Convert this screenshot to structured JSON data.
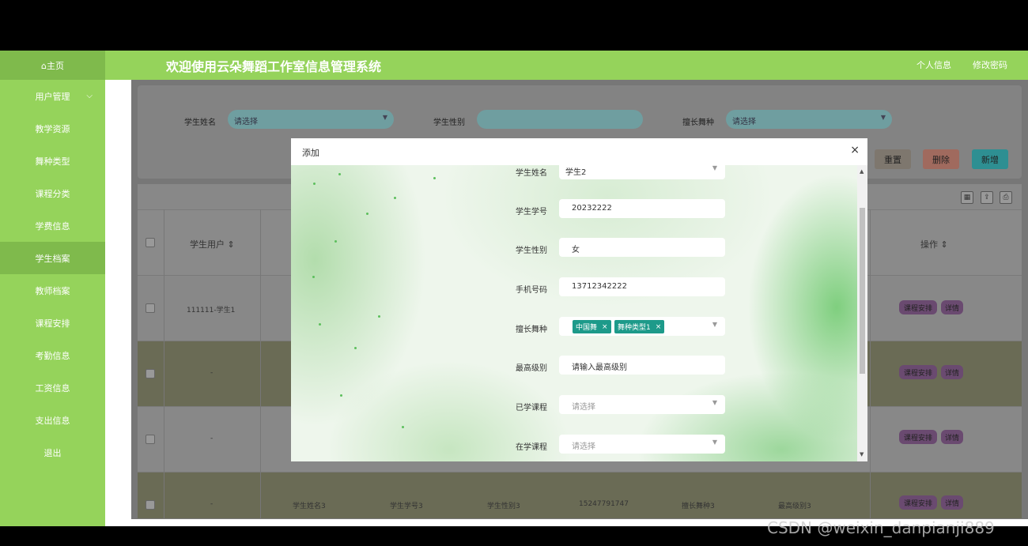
{
  "sidebar": {
    "home": "⌂主页",
    "items": [
      {
        "label": "用户管理",
        "chevron": "⌵"
      },
      {
        "label": "教学资源"
      },
      {
        "label": "舞种类型"
      },
      {
        "label": "课程分类"
      },
      {
        "label": "学费信息"
      },
      {
        "label": "学生档案"
      },
      {
        "label": "教师档案"
      },
      {
        "label": "课程安排"
      },
      {
        "label": "考勤信息"
      },
      {
        "label": "工资信息"
      },
      {
        "label": "支出信息"
      },
      {
        "label": "退出"
      }
    ],
    "active_index": 5
  },
  "header": {
    "title": "欢迎使用云朵舞蹈工作室信息管理系统",
    "profile": "个人信息",
    "change_password": "修改密码"
  },
  "search": {
    "student_name_label": "学生姓名",
    "student_name_placeholder": "请选择",
    "student_gender_label": "学生性别",
    "dance_specialty_label": "擅长舞种",
    "dance_specialty_placeholder": "请选择",
    "reset": "重置",
    "delete": "删除",
    "add": "新增"
  },
  "table": {
    "headers": {
      "student_user": "学生用户 ⇕",
      "actions": "操作 ⇕"
    },
    "rows": [
      {
        "user": "111111-学生1"
      },
      {
        "user": "-"
      },
      {
        "user": "-"
      },
      {
        "user": "-",
        "name": "学生姓名3",
        "number": "学生学号3",
        "gender": "学生性别3",
        "phone": "15247791747",
        "dance": "擅长舞种3",
        "level": "最高级别3"
      }
    ],
    "btn_schedule": "课程安排",
    "btn_detail": "详情"
  },
  "dialog": {
    "title": "添加",
    "close": "×",
    "fields": {
      "name_label": "学生姓名",
      "name_value": "学生2",
      "number_label": "学生学号",
      "number_value": "20232222",
      "gender_label": "学生性别",
      "gender_value": "女",
      "phone_label": "手机号码",
      "phone_value": "13712342222",
      "dance_label": "擅长舞种",
      "dance_tags": [
        "中国舞",
        "舞种类型1"
      ],
      "level_label": "最高级别",
      "level_placeholder": "请输入最高级别",
      "learned_label": "已学课程",
      "learned_placeholder": "请选择",
      "current_label": "在学课程",
      "current_placeholder": "请选择"
    }
  },
  "watermark": "CSDN @weixin_danpianji889"
}
